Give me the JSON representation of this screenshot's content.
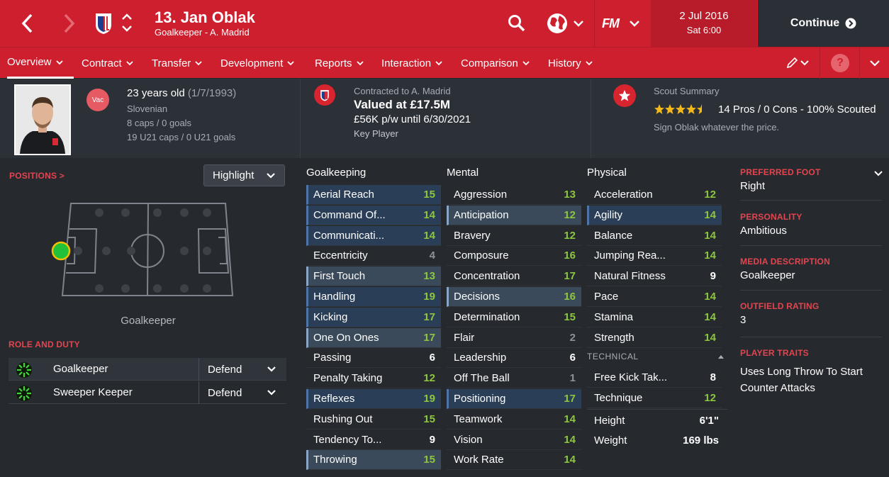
{
  "header": {
    "player_name": "13. Jan Oblak",
    "player_sub": "Goalkeeper - A. Madrid",
    "date": "2 Jul 2016",
    "time": "Sat 6:00",
    "continue_label": "Continue",
    "fm_label": "FM"
  },
  "nav": {
    "tabs": [
      {
        "label": "Overview"
      },
      {
        "label": "Contract"
      },
      {
        "label": "Transfer"
      },
      {
        "label": "Development"
      },
      {
        "label": "Reports"
      },
      {
        "label": "Interaction"
      },
      {
        "label": "Comparison"
      },
      {
        "label": "History"
      }
    ]
  },
  "bio": {
    "age": "23 years old",
    "dob": "(1/7/1993)",
    "nationality": "Slovenian",
    "caps": "8 caps / 0 goals",
    "u21caps": "19 U21 caps / 0 U21 goals",
    "badge": "Vac"
  },
  "contract": {
    "club": "Contracted to A. Madrid",
    "value": "Valued at £17.5M",
    "wage": "£56K p/w until 6/30/2021",
    "status": "Key Player"
  },
  "scout": {
    "title": "Scout Summary",
    "summary": "14 Pros / 0 Cons - 100% Scouted",
    "note": "Sign Oblak whatever the price.",
    "stars": 4.5
  },
  "positions": {
    "label": "POSITIONS",
    "highlight": "Highlight",
    "pos_name": "Goalkeeper"
  },
  "roles": {
    "label": "ROLE AND DUTY",
    "items": [
      {
        "role": "Goalkeeper",
        "duty": "Defend"
      },
      {
        "role": "Sweeper Keeper",
        "duty": "Defend"
      }
    ]
  },
  "attrs": {
    "goalkeeping_title": "Goalkeeping",
    "mental_title": "Mental",
    "physical_title": "Physical",
    "technical_title": "TECHNICAL",
    "goalkeeping": [
      {
        "name": "Aerial Reach",
        "value": "15"
      },
      {
        "name": "Command Of...",
        "value": "14"
      },
      {
        "name": "Communicati...",
        "value": "14"
      },
      {
        "name": "Eccentricity",
        "value": "4"
      },
      {
        "name": "First Touch",
        "value": "13"
      },
      {
        "name": "Handling",
        "value": "19"
      },
      {
        "name": "Kicking",
        "value": "17"
      },
      {
        "name": "One On Ones",
        "value": "17"
      },
      {
        "name": "Passing",
        "value": "6"
      },
      {
        "name": "Penalty Taking",
        "value": "12"
      },
      {
        "name": "Reflexes",
        "value": "19"
      },
      {
        "name": "Rushing Out",
        "value": "15"
      },
      {
        "name": "Tendency To...",
        "value": "9"
      },
      {
        "name": "Throwing",
        "value": "15"
      }
    ],
    "mental": [
      {
        "name": "Aggression",
        "value": "13"
      },
      {
        "name": "Anticipation",
        "value": "12"
      },
      {
        "name": "Bravery",
        "value": "12"
      },
      {
        "name": "Composure",
        "value": "16"
      },
      {
        "name": "Concentration",
        "value": "17"
      },
      {
        "name": "Decisions",
        "value": "16"
      },
      {
        "name": "Determination",
        "value": "15"
      },
      {
        "name": "Flair",
        "value": "2"
      },
      {
        "name": "Leadership",
        "value": "6"
      },
      {
        "name": "Off The Ball",
        "value": "1"
      },
      {
        "name": "Positioning",
        "value": "17"
      },
      {
        "name": "Teamwork",
        "value": "14"
      },
      {
        "name": "Vision",
        "value": "14"
      },
      {
        "name": "Work Rate",
        "value": "14"
      }
    ],
    "physical": [
      {
        "name": "Acceleration",
        "value": "12"
      },
      {
        "name": "Agility",
        "value": "14"
      },
      {
        "name": "Balance",
        "value": "14"
      },
      {
        "name": "Jumping Rea...",
        "value": "14"
      },
      {
        "name": "Natural Fitness",
        "value": "9"
      },
      {
        "name": "Pace",
        "value": "14"
      },
      {
        "name": "Stamina",
        "value": "14"
      },
      {
        "name": "Strength",
        "value": "14"
      }
    ],
    "technical": [
      {
        "name": "Free Kick Tak...",
        "value": "8"
      },
      {
        "name": "Technique",
        "value": "12"
      }
    ],
    "height_label": "Height",
    "height": "6'1\"",
    "weight_label": "Weight",
    "weight": "169 lbs"
  },
  "right_panel": {
    "items": [
      {
        "label": "PREFERRED FOOT",
        "value": "Right"
      },
      {
        "label": "PERSONALITY",
        "value": "Ambitious"
      },
      {
        "label": "MEDIA DESCRIPTION",
        "value": "Goalkeeper"
      },
      {
        "label": "OUTFIELD RATING",
        "value": "3"
      },
      {
        "label": "PLAYER TRAITS",
        "value": "Uses Long Throw To Start Counter Attacks"
      }
    ]
  },
  "colors": {
    "red": "#ce1f2e",
    "dark": "#26292e",
    "green": "#8dc63f",
    "highlight": "#2b3e58"
  }
}
